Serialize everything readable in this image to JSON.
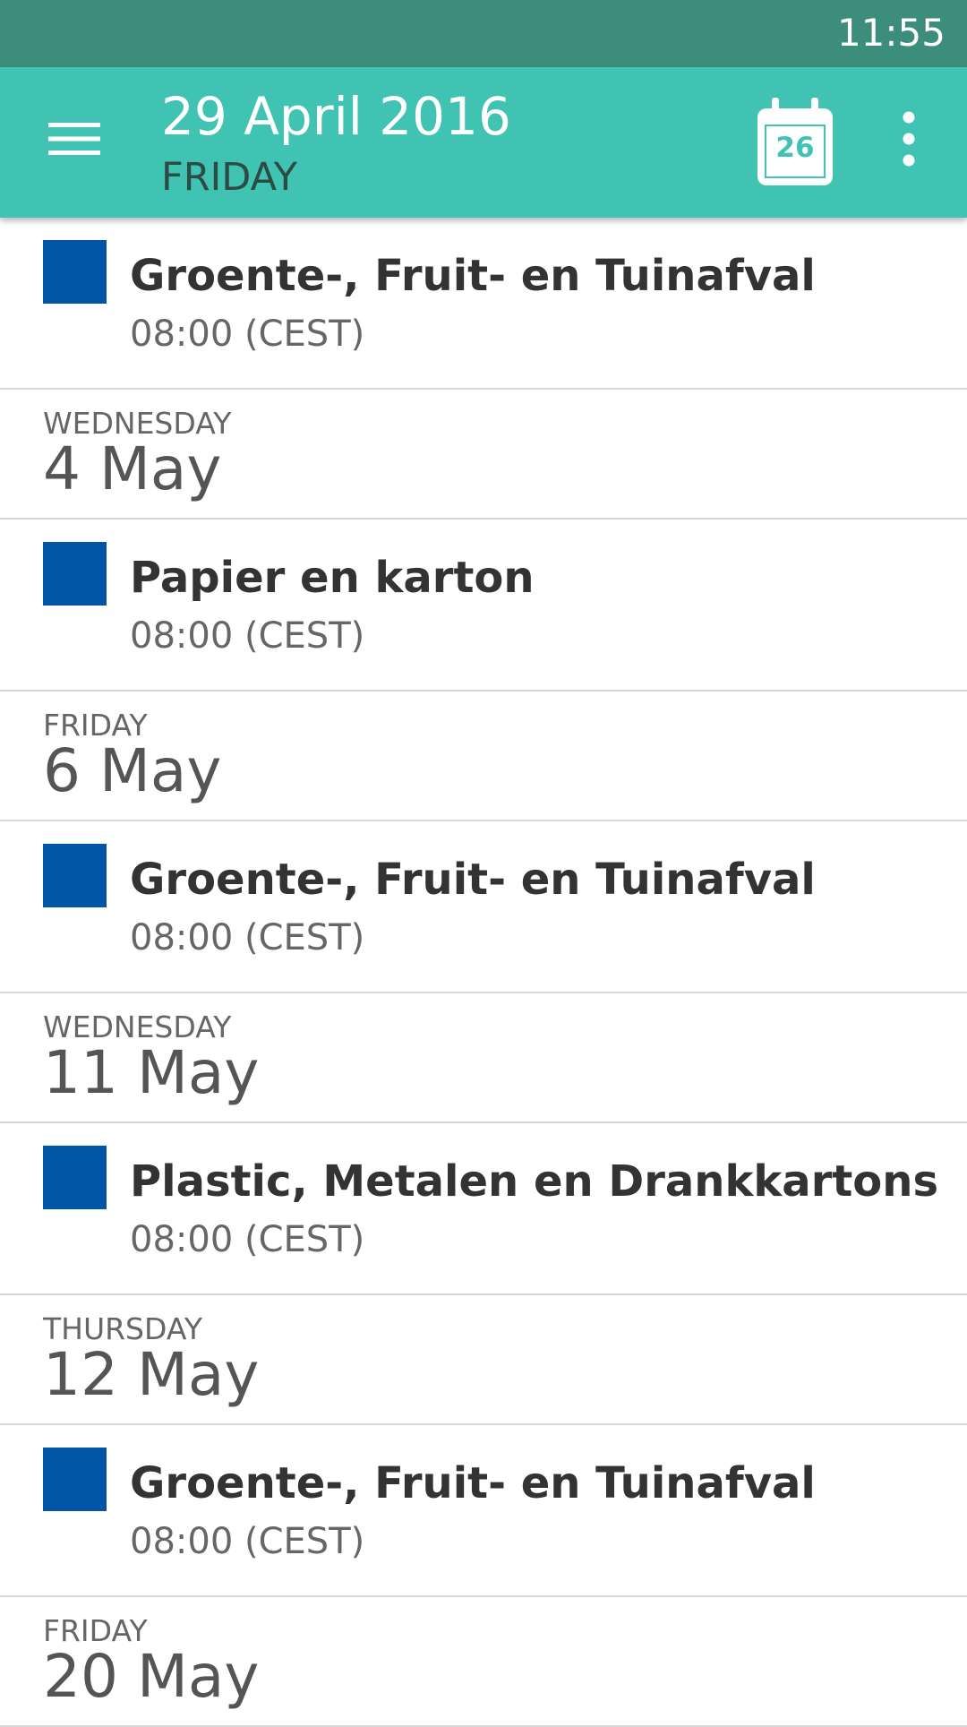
{
  "status_bar": {
    "time": "11:55"
  },
  "app_bar": {
    "date": "29 April 2016",
    "weekday": "FRIDAY",
    "calendar_day": "26"
  },
  "list": [
    {
      "type": "event",
      "title": "Groente-, Fruit- en Tuinafval",
      "time": "08:00 (CEST)",
      "color": "#0055A5"
    },
    {
      "type": "date",
      "weekday": "WEDNESDAY",
      "day": "4 May"
    },
    {
      "type": "event",
      "title": "Papier en karton",
      "time": "08:00 (CEST)",
      "color": "#0055A5"
    },
    {
      "type": "date",
      "weekday": "FRIDAY",
      "day": "6 May"
    },
    {
      "type": "event",
      "title": "Groente-, Fruit- en Tuinafval",
      "time": "08:00 (CEST)",
      "color": "#0055A5"
    },
    {
      "type": "date",
      "weekday": "WEDNESDAY",
      "day": "11 May"
    },
    {
      "type": "event",
      "title": "Plastic, Metalen en Drankkartons",
      "time": "08:00 (CEST)",
      "color": "#0055A5"
    },
    {
      "type": "date",
      "weekday": "THURSDAY",
      "day": "12 May"
    },
    {
      "type": "event",
      "title": "Groente-, Fruit- en Tuinafval",
      "time": "08:00 (CEST)",
      "color": "#0055A5"
    },
    {
      "type": "date",
      "weekday": "FRIDAY",
      "day": "20 May"
    }
  ],
  "colors": {
    "status_bar": "#3C8D7B",
    "app_bar": "#40C3B2",
    "event_swatch": "#0055A5"
  },
  "icons": {
    "menu": "hamburger-menu-icon",
    "calendar": "calendar-icon",
    "more": "more-vert-icon"
  }
}
